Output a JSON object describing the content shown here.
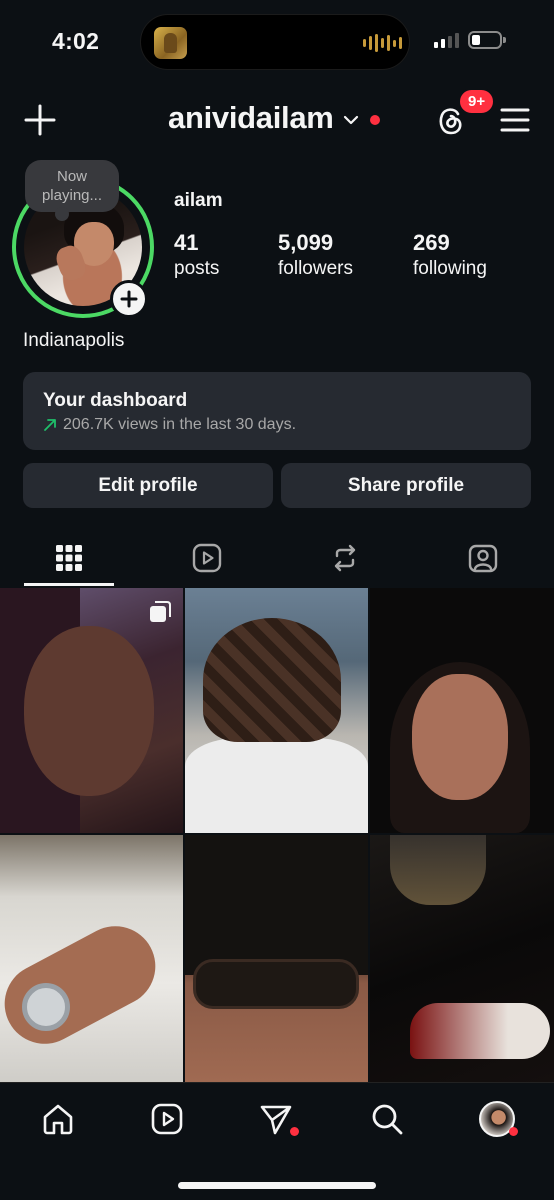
{
  "status_bar": {
    "time": "4:02"
  },
  "header": {
    "username": "anividailam",
    "notification_badge": "9+"
  },
  "profile": {
    "note": "Now playing...",
    "display_name": "ailam",
    "location": "Indianapolis",
    "stats": [
      {
        "value": "41",
        "label": "posts"
      },
      {
        "value": "5,099",
        "label": "followers"
      },
      {
        "value": "269",
        "label": "following"
      }
    ]
  },
  "dashboard": {
    "title": "Your dashboard",
    "subtitle": "206.7K views in the last 30 days."
  },
  "buttons": {
    "edit": "Edit profile",
    "share": "Share profile"
  },
  "tabs": [
    {
      "name": "grid-icon"
    },
    {
      "name": "reels-icon"
    },
    {
      "name": "reposts-icon"
    },
    {
      "name": "tagged-icon"
    }
  ],
  "bottom_nav": [
    {
      "name": "home-icon"
    },
    {
      "name": "reels-icon"
    },
    {
      "name": "direct-messages-icon"
    },
    {
      "name": "search-icon"
    },
    {
      "name": "profile-avatar"
    }
  ],
  "colors": {
    "background": "#0c1014",
    "card": "#262a31",
    "accent_red": "#ff3040",
    "story_ring": "#4cd964",
    "dashboard_arrow": "#1fbf6a"
  }
}
